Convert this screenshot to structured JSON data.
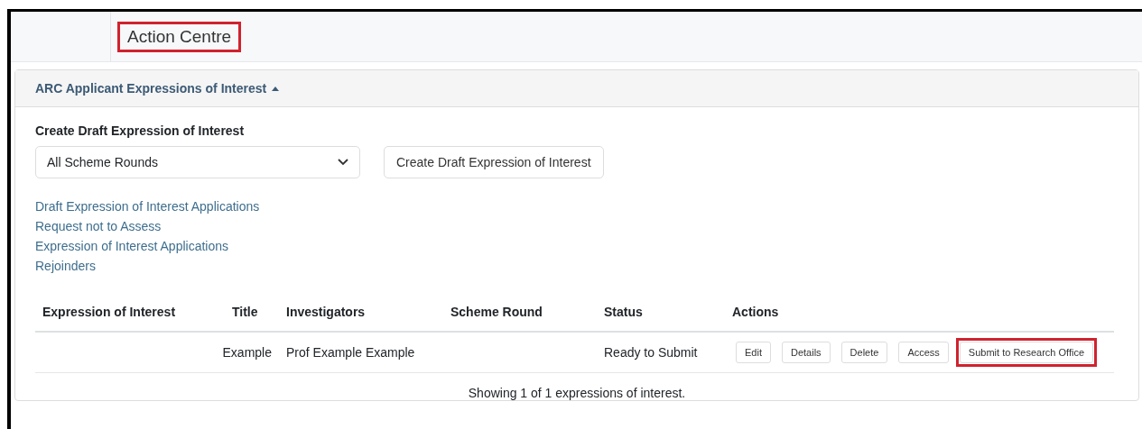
{
  "header": {
    "title": "Action Centre",
    "highlighted": true
  },
  "panel": {
    "title": "ARC Applicant Expressions of Interest",
    "expanded": true,
    "create": {
      "heading": "Create Draft Expression of Interest",
      "select": {
        "value": "All Scheme Rounds"
      },
      "button": "Create Draft Expression of Interest"
    },
    "links": [
      "Draft Expression of Interest Applications",
      "Request not to Assess",
      "Expression of Interest Applications",
      "Rejoinders"
    ],
    "table": {
      "columns": [
        "Expression of Interest",
        "Title",
        "Investigators",
        "Scheme Round",
        "Status",
        "Actions"
      ],
      "rows": [
        {
          "cells": [
            "",
            "Example",
            "Prof Example Example",
            "",
            "Ready to Submit"
          ],
          "actions": [
            {
              "label": "Edit",
              "highlighted": false
            },
            {
              "label": "Details",
              "highlighted": false
            },
            {
              "label": "Delete",
              "highlighted": false
            },
            {
              "label": "Access",
              "highlighted": false
            },
            {
              "label": "Submit to Research Office",
              "highlighted": true
            }
          ]
        }
      ]
    },
    "footer": "Showing 1 of 1 expressions of interest."
  }
}
